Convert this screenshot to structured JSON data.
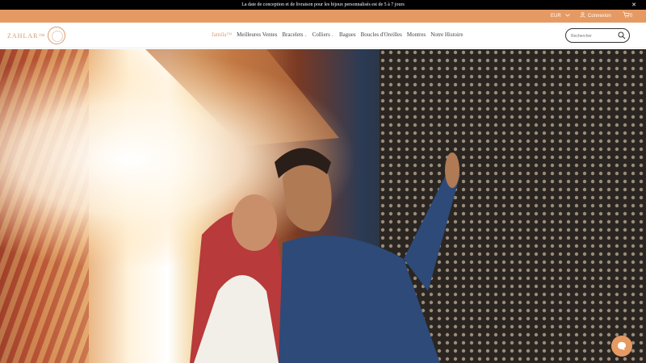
{
  "announcement": {
    "text": "La date de conception et de livraison pour les bijoux personnalisés est de 5 à 7 jours",
    "close": "✕"
  },
  "utility": {
    "currency": "EUR",
    "account": "Connexion",
    "cart_count": "0"
  },
  "brand": {
    "name": "ZAHLAR™"
  },
  "nav": [
    {
      "label": "Jamila™",
      "has_menu": false,
      "active": true
    },
    {
      "label": "Meilleures Ventes",
      "has_menu": false,
      "active": false
    },
    {
      "label": "Bracelets",
      "has_menu": true,
      "active": false
    },
    {
      "label": "Colliers",
      "has_menu": true,
      "active": false
    },
    {
      "label": "Bagues",
      "has_menu": false,
      "active": false
    },
    {
      "label": "Boucles d'Oreilles",
      "has_menu": false,
      "active": false
    },
    {
      "label": "Montres",
      "has_menu": false,
      "active": false
    },
    {
      "label": "Notre Histoire",
      "has_menu": false,
      "active": false
    }
  ],
  "search": {
    "placeholder": "Rechercher"
  },
  "colors": {
    "accent": "#e59a63",
    "brand": "#d99a6c",
    "announce_bg": "#000000"
  }
}
